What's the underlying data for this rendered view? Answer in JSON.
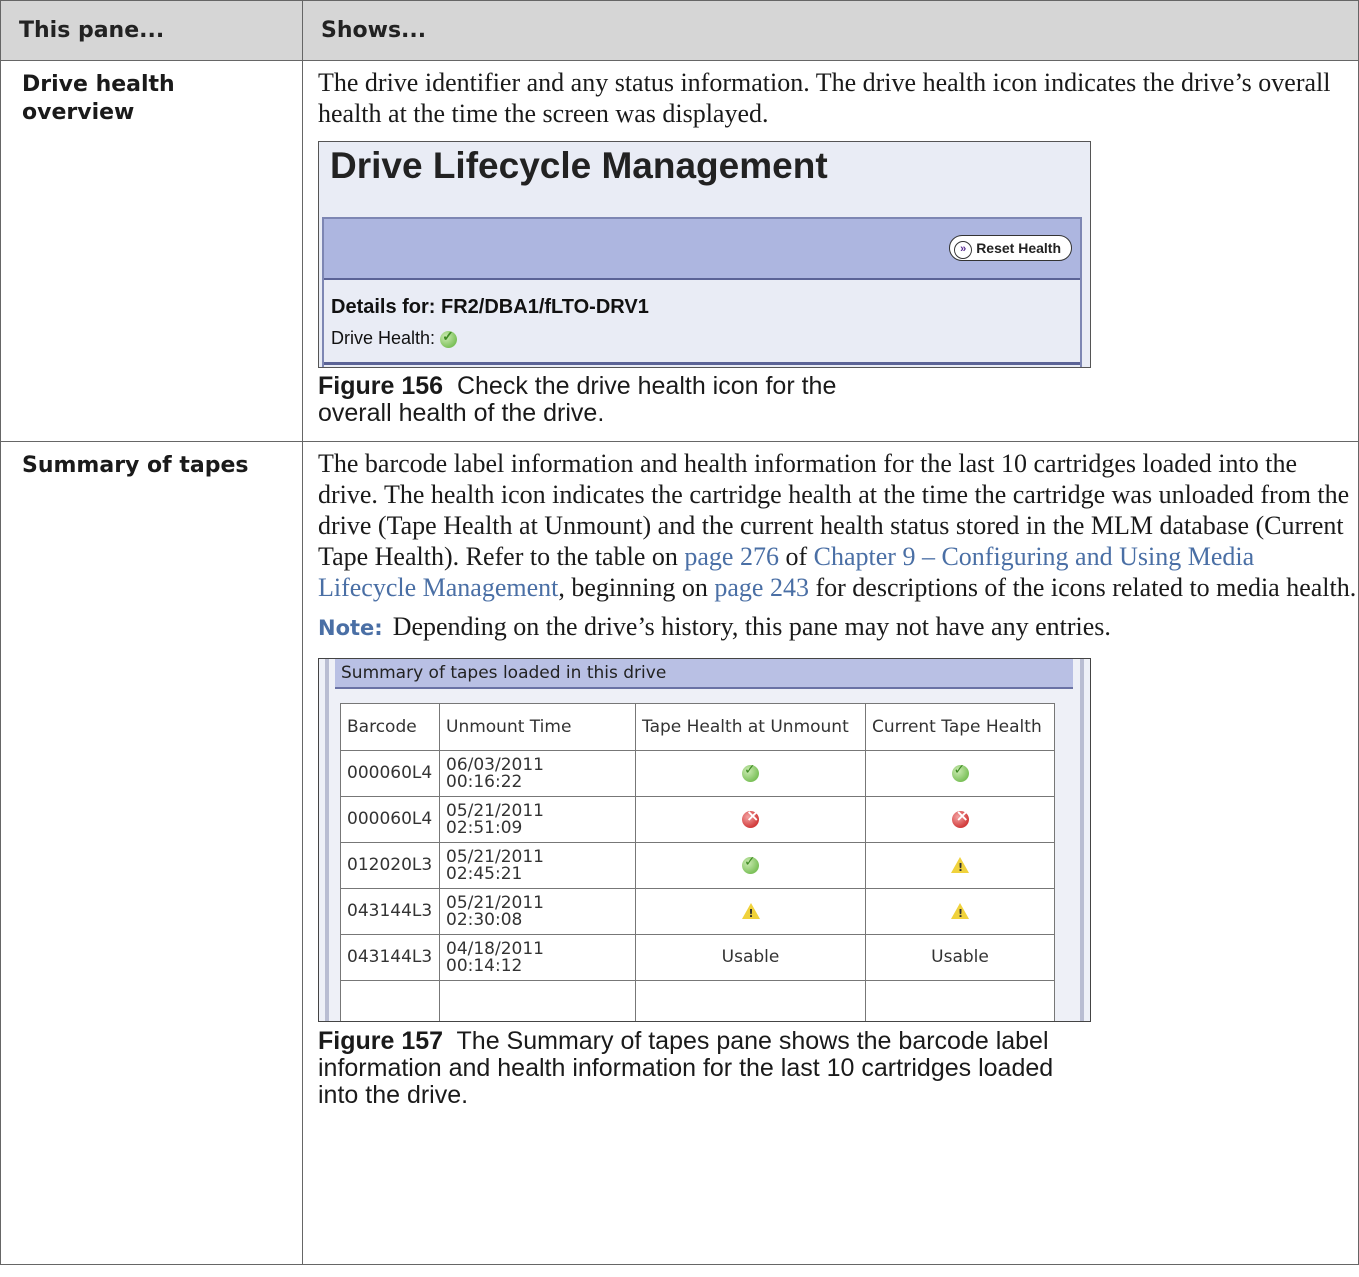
{
  "table": {
    "col_headers": [
      "This pane...",
      "Shows..."
    ]
  },
  "rows": [
    {
      "pane": "Drive health overview",
      "description": "The drive identifier and any status information. The drive health icon indicates the drive’s overall health at the time the screen was displayed.",
      "screenshot": {
        "title": "Drive Lifecycle Management",
        "button_label": "Reset Health",
        "details_label": "Details for: FR2/DBA1/fLTO-DRV1",
        "health_label": "Drive Health:",
        "health_status": "good"
      },
      "caption_label": "Figure 156",
      "caption_text": "Check the drive health icon for the overall health of the drive."
    },
    {
      "pane": "Summary of tapes",
      "desc_part1": "The barcode label information and health information for the last 10 cartridges loaded into the drive. The health icon indicates the cartridge health at the time the cartridge was unloaded from the drive (Tape Health at Unmount) and the current health status stored in the MLM database (Current Tape Health). Refer to the table on ",
      "link_page1": "page 276",
      "desc_part2": " of ",
      "link_chapter": "Chapter 9 – Configuring and Using Media Lifecycle Management",
      "desc_part3": ", beginning on ",
      "link_page2": "page 243",
      "desc_part4": " for descriptions of the icons related to media health.",
      "note_label": "Note:",
      "note_text": "Depending on the drive’s history, this pane may not have any entries.",
      "screenshot": {
        "header": "Summary of tapes loaded in this drive",
        "columns": [
          "Barcode",
          "Unmount Time",
          "Tape Health at Unmount",
          "Current Tape Health"
        ],
        "rows": [
          {
            "barcode": "000060L4",
            "date": "06/03/2011",
            "time": "00:16:22",
            "unmount": "good",
            "current": "good"
          },
          {
            "barcode": "000060L4",
            "date": "05/21/2011",
            "time": "02:51:09",
            "unmount": "bad",
            "current": "bad"
          },
          {
            "barcode": "012020L3",
            "date": "05/21/2011",
            "time": "02:45:21",
            "unmount": "good",
            "current": "warning"
          },
          {
            "barcode": "043144L3",
            "date": "05/21/2011",
            "time": "02:30:08",
            "unmount": "warning",
            "current": "warning"
          },
          {
            "barcode": "043144L3",
            "date": "04/18/2011",
            "time": "00:14:12",
            "unmount_text": "Usable",
            "current_text": "Usable"
          }
        ]
      },
      "caption_label": "Figure 157",
      "caption_text": "The Summary of tapes pane shows the barcode label information and health information for the last 10 cartridges loaded into the drive."
    }
  ]
}
